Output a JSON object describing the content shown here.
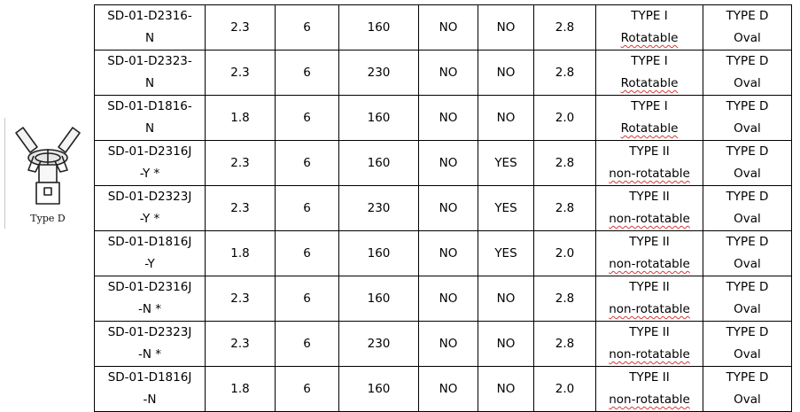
{
  "image_label": "Type D",
  "rows": [
    {
      "part": [
        "SD-01-D2316-",
        "N"
      ],
      "c1": "2.3",
      "c2": "6",
      "c3": "160",
      "c4": "NO",
      "c5": "NO",
      "c6": "2.8",
      "type": [
        "TYPE I",
        "Rotatable"
      ],
      "style": [
        "TYPE D",
        "Oval"
      ]
    },
    {
      "part": [
        "SD-01-D2323-",
        "N"
      ],
      "c1": "2.3",
      "c2": "6",
      "c3": "230",
      "c4": "NO",
      "c5": "NO",
      "c6": "2.8",
      "type": [
        "TYPE I",
        "Rotatable"
      ],
      "style": [
        "TYPE D",
        "Oval"
      ]
    },
    {
      "part": [
        "SD-01-D1816-",
        "N"
      ],
      "c1": "1.8",
      "c2": "6",
      "c3": "160",
      "c4": "NO",
      "c5": "NO",
      "c6": "2.0",
      "type": [
        "TYPE I",
        "Rotatable"
      ],
      "style": [
        "TYPE D",
        "Oval"
      ]
    },
    {
      "part": [
        "SD-01-D2316J",
        "-Y *"
      ],
      "c1": "2.3",
      "c2": "6",
      "c3": "160",
      "c4": "NO",
      "c5": "YES",
      "c6": "2.8",
      "type": [
        "TYPE II",
        "non-rotatable"
      ],
      "style": [
        "TYPE D",
        "Oval"
      ]
    },
    {
      "part": [
        "SD-01-D2323J",
        "-Y *"
      ],
      "c1": "2.3",
      "c2": "6",
      "c3": "230",
      "c4": "NO",
      "c5": "YES",
      "c6": "2.8",
      "type": [
        "TYPE II",
        "non-rotatable"
      ],
      "style": [
        "TYPE D",
        "Oval"
      ]
    },
    {
      "part": [
        "SD-01-D1816J",
        "-Y"
      ],
      "c1": "1.8",
      "c2": "6",
      "c3": "160",
      "c4": "NO",
      "c5": "YES",
      "c6": "2.0",
      "type": [
        "TYPE II",
        "non-rotatable"
      ],
      "style": [
        "TYPE D",
        "Oval"
      ]
    },
    {
      "part": [
        "SD-01-D2316J",
        "-N *"
      ],
      "c1": "2.3",
      "c2": "6",
      "c3": "160",
      "c4": "NO",
      "c5": "NO",
      "c6": "2.8",
      "type": [
        "TYPE II",
        "non-rotatable"
      ],
      "style": [
        "TYPE D",
        "Oval"
      ]
    },
    {
      "part": [
        "SD-01-D2323J",
        "-N *"
      ],
      "c1": "2.3",
      "c2": "6",
      "c3": "230",
      "c4": "NO",
      "c5": "NO",
      "c6": "2.8",
      "type": [
        "TYPE II",
        "non-rotatable"
      ],
      "style": [
        "TYPE D",
        "Oval"
      ]
    },
    {
      "part": [
        "SD-01-D1816J",
        "-N"
      ],
      "c1": "1.8",
      "c2": "6",
      "c3": "160",
      "c4": "NO",
      "c5": "NO",
      "c6": "2.0",
      "type": [
        "TYPE II",
        "non-rotatable"
      ],
      "style": [
        "TYPE D",
        "Oval"
      ]
    }
  ]
}
